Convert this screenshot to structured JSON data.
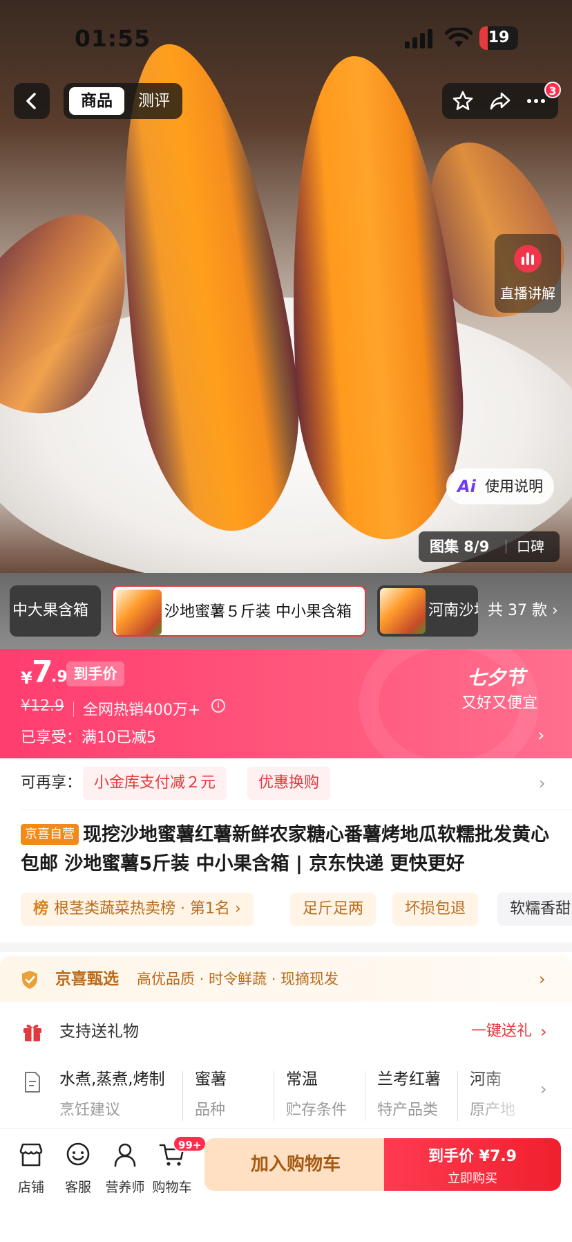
{
  "status_bar": {
    "time": "01:55",
    "battery": "19"
  },
  "nav": {
    "tab_product": "商品",
    "tab_review": "测评",
    "more_badge": "3"
  },
  "hero": {
    "live_label": "直播讲解",
    "guide_label": "使用说明",
    "gallery_count": "图集 8/9",
    "gallery_reviews": "口碑"
  },
  "sku": {
    "items": [
      "中大果含箱",
      "沙地蜜薯５斤装 中小果含箱",
      "河南沙地"
    ],
    "total": "共 37 款 ›"
  },
  "price": {
    "currency": "¥",
    "integer": "7",
    "decimal": ".9",
    "tag": "到手价",
    "original": "¥12.9",
    "sales": "全网热销400万+",
    "enjoyed": "已享受：满10已减5",
    "festival_title": "七夕节",
    "festival_sub": "又好又便宜"
  },
  "coupons": {
    "label": "可再享：",
    "chips": [
      "小金库支付减２元",
      "优惠换购"
    ]
  },
  "title": {
    "badge": "京喜自营",
    "text": "现挖沙地蜜薯红薯新鲜农家糖心番薯烤地瓜软糯批发黄心包邮 沙地蜜薯5斤装 中小果含箱 | 京东快递 更快更好"
  },
  "tags": {
    "rank_icon": "榜",
    "rank": "根茎类蔬菜热卖榜 · 第1名 ›",
    "items": [
      "足斤足两",
      "坏损包退",
      "软糯香甜"
    ]
  },
  "jingxi": {
    "title": "京喜甄选",
    "desc": "高优品质 · 时令鲜蔬 · 现摘现发"
  },
  "gift": {
    "label": "支持送礼物",
    "action": "一键送礼"
  },
  "specs": [
    {
      "value": "水煮,蒸煮,烤制",
      "key": "烹饪建议"
    },
    {
      "value": "蜜薯",
      "key": "品种"
    },
    {
      "value": "常温",
      "key": "贮存条件"
    },
    {
      "value": "兰考红薯",
      "key": "特产品类"
    },
    {
      "value": "河南",
      "key": "原产地"
    }
  ],
  "bottom": {
    "store": "店铺",
    "service": "客服",
    "nutritionist": "营养师",
    "cart": "购物车",
    "cart_badge": "99+",
    "add_cart": "加入购物车",
    "buy_top": "到手价 ¥7.9",
    "buy_sub": "立即购买"
  },
  "colors": {
    "accent": "#e4393c",
    "price_banner": "#ff4f78",
    "jingxi": "#b86b1c"
  }
}
